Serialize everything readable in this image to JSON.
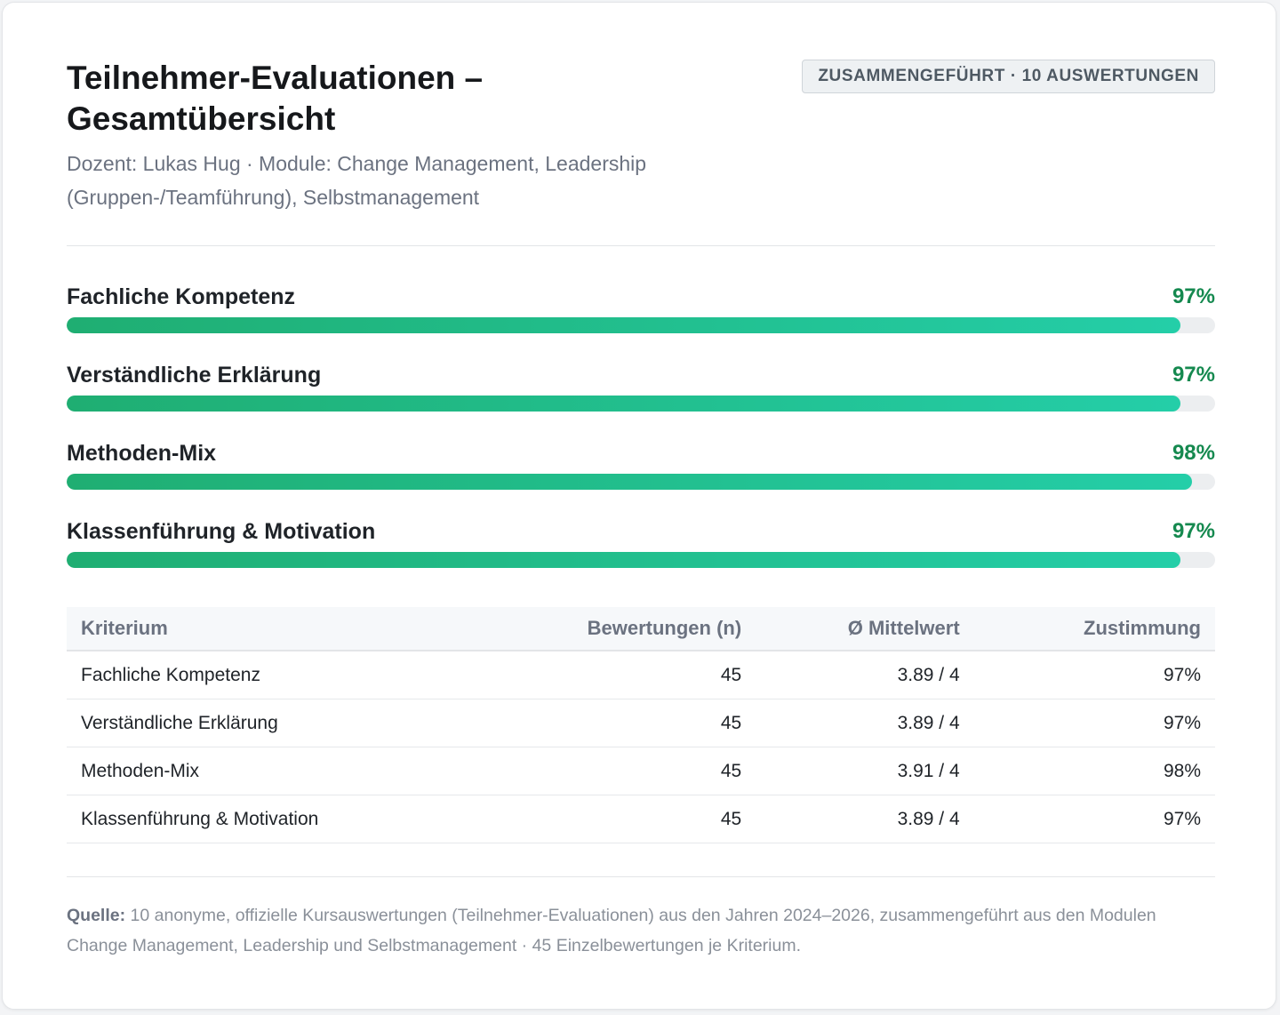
{
  "header": {
    "title": "Teilnehmer-Evaluationen – Gesamtübersicht",
    "subtitle": "Dozent: Lukas Hug · Module: Change Management, Leadership (Gruppen-/Teamführung), Selbstmanagement",
    "badge": "ZUSAMMENGEFÜHRT · 10 AUSWERTUNGEN"
  },
  "metrics": [
    {
      "label": "Fachliche Kompetenz",
      "value": "97%",
      "percent": 97
    },
    {
      "label": "Verständliche Erklärung",
      "value": "97%",
      "percent": 97
    },
    {
      "label": "Methoden-Mix",
      "value": "98%",
      "percent": 98
    },
    {
      "label": "Klassenführung & Motivation",
      "value": "97%",
      "percent": 97
    }
  ],
  "table": {
    "headers": [
      "Kriterium",
      "Bewertungen (n)",
      "Ø Mittelwert",
      "Zustimmung"
    ],
    "rows": [
      [
        "Fachliche Kompetenz",
        "45",
        "3.89 / 4",
        "97%"
      ],
      [
        "Verständliche Erklärung",
        "45",
        "3.89 / 4",
        "97%"
      ],
      [
        "Methoden-Mix",
        "45",
        "3.91 / 4",
        "98%"
      ],
      [
        "Klassenführung & Motivation",
        "45",
        "3.89 / 4",
        "97%"
      ]
    ]
  },
  "footer": {
    "label": "Quelle:",
    "text": "10 anonyme, offizielle Kursauswertungen (Teilnehmer-Evaluationen) aus den Jahren 2024–2026, zusammengeführt aus den Modulen Change Management, Leadership und Selbstmanagement · 45 Einzelbewertungen je Kriterium."
  },
  "colors": {
    "accent": "#15894f",
    "bar_start": "#1fae72",
    "bar_end": "#24cea8",
    "track": "#eceef0",
    "muted": "#6b7280"
  }
}
